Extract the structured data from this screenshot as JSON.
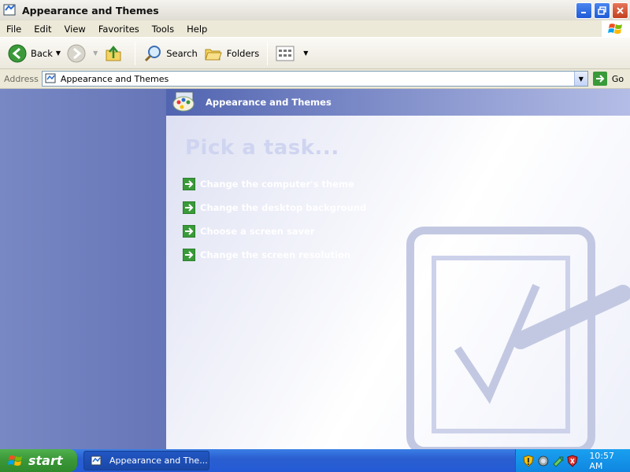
{
  "window": {
    "title": "Appearance and Themes"
  },
  "menu": {
    "items": [
      "File",
      "Edit",
      "View",
      "Favorites",
      "Tools",
      "Help"
    ]
  },
  "toolbar": {
    "back_label": "Back",
    "search_label": "Search",
    "folders_label": "Folders"
  },
  "address": {
    "label": "Address",
    "value": "Appearance and Themes",
    "go_label": "Go"
  },
  "content": {
    "category_title": "Appearance and Themes",
    "heading": "Pick a task...",
    "tasks": [
      "Change the computer's theme",
      "Change the desktop background",
      "Choose a screen saver",
      "Change the screen resolution"
    ]
  },
  "taskbar": {
    "start_label": "start",
    "app_label": "Appearance and The...",
    "clock": "10:57 AM"
  },
  "colors": {
    "title_bar": "#ece9d8",
    "category_header": "#5164b0",
    "task_link": "#ffffff",
    "task_arrow": "#3a9a3a",
    "taskbar": "#245ad6",
    "start_button": "#3a9637"
  }
}
